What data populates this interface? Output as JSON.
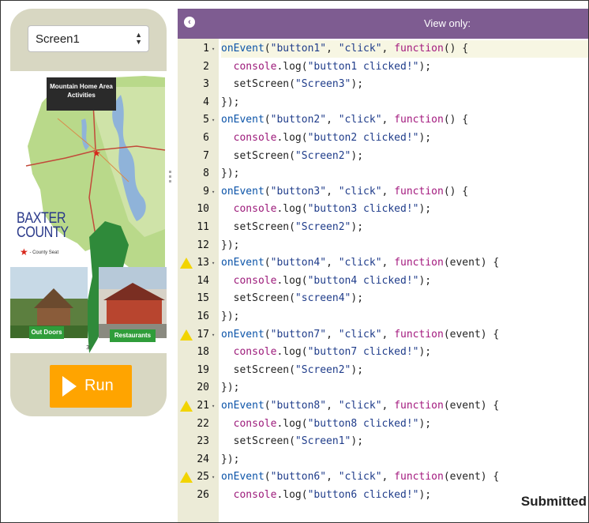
{
  "phone": {
    "screen_select_value": "Screen1",
    "preview": {
      "map_title": "Mountain Home Area Activities",
      "county_line1": "BAXTER",
      "county_line2": "COUNTY",
      "county_seat": "- County Seat",
      "outdoors_button": "Out Doors",
      "restaurants_button": "Restaurants"
    },
    "run_label": "Run"
  },
  "editor": {
    "header_title": "View only:",
    "status": "Submitted",
    "lines": [
      {
        "n": "1",
        "fold": true,
        "warn": false,
        "parts": [
          [
            "fn",
            "onEvent"
          ],
          [
            "p",
            "("
          ],
          [
            "str",
            "\"button1\""
          ],
          [
            "p",
            ", "
          ],
          [
            "str",
            "\"click\""
          ],
          [
            "p",
            ", "
          ],
          [
            "kw",
            "function"
          ],
          [
            "p",
            "() {"
          ]
        ]
      },
      {
        "n": "2",
        "fold": false,
        "warn": false,
        "parts": [
          [
            "p",
            "  "
          ],
          [
            "con",
            "console"
          ],
          [
            "p",
            ".log("
          ],
          [
            "str",
            "\"button1 clicked!\""
          ],
          [
            "p",
            ");"
          ]
        ]
      },
      {
        "n": "3",
        "fold": false,
        "warn": false,
        "parts": [
          [
            "p",
            "  setScreen("
          ],
          [
            "str",
            "\"Screen3\""
          ],
          [
            "p",
            ");"
          ]
        ]
      },
      {
        "n": "4",
        "fold": false,
        "warn": false,
        "parts": [
          [
            "p",
            "});"
          ]
        ]
      },
      {
        "n": "5",
        "fold": true,
        "warn": false,
        "parts": [
          [
            "fn",
            "onEvent"
          ],
          [
            "p",
            "("
          ],
          [
            "str",
            "\"button2\""
          ],
          [
            "p",
            ", "
          ],
          [
            "str",
            "\"click\""
          ],
          [
            "p",
            ", "
          ],
          [
            "kw",
            "function"
          ],
          [
            "p",
            "() {"
          ]
        ]
      },
      {
        "n": "6",
        "fold": false,
        "warn": false,
        "parts": [
          [
            "p",
            "  "
          ],
          [
            "con",
            "console"
          ],
          [
            "p",
            ".log("
          ],
          [
            "str",
            "\"button2 clicked!\""
          ],
          [
            "p",
            ");"
          ]
        ]
      },
      {
        "n": "7",
        "fold": false,
        "warn": false,
        "parts": [
          [
            "p",
            "  setScreen("
          ],
          [
            "str",
            "\"Screen2\""
          ],
          [
            "p",
            ");"
          ]
        ]
      },
      {
        "n": "8",
        "fold": false,
        "warn": false,
        "parts": [
          [
            "p",
            "});"
          ]
        ]
      },
      {
        "n": "9",
        "fold": true,
        "warn": false,
        "parts": [
          [
            "fn",
            "onEvent"
          ],
          [
            "p",
            "("
          ],
          [
            "str",
            "\"button3\""
          ],
          [
            "p",
            ", "
          ],
          [
            "str",
            "\"click\""
          ],
          [
            "p",
            ", "
          ],
          [
            "kw",
            "function"
          ],
          [
            "p",
            "() {"
          ]
        ]
      },
      {
        "n": "10",
        "fold": false,
        "warn": false,
        "parts": [
          [
            "p",
            "  "
          ],
          [
            "con",
            "console"
          ],
          [
            "p",
            ".log("
          ],
          [
            "str",
            "\"button3 clicked!\""
          ],
          [
            "p",
            ");"
          ]
        ]
      },
      {
        "n": "11",
        "fold": false,
        "warn": false,
        "parts": [
          [
            "p",
            "  setScreen("
          ],
          [
            "str",
            "\"Screen2\""
          ],
          [
            "p",
            ");"
          ]
        ]
      },
      {
        "n": "12",
        "fold": false,
        "warn": false,
        "parts": [
          [
            "p",
            "});"
          ]
        ]
      },
      {
        "n": "13",
        "fold": true,
        "warn": true,
        "parts": [
          [
            "fn",
            "onEvent"
          ],
          [
            "p",
            "("
          ],
          [
            "str",
            "\"button4\""
          ],
          [
            "p",
            ", "
          ],
          [
            "str",
            "\"click\""
          ],
          [
            "p",
            ", "
          ],
          [
            "kw",
            "function"
          ],
          [
            "p",
            "(event) {"
          ]
        ]
      },
      {
        "n": "14",
        "fold": false,
        "warn": false,
        "parts": [
          [
            "p",
            "  "
          ],
          [
            "con",
            "console"
          ],
          [
            "p",
            ".log("
          ],
          [
            "str",
            "\"button4 clicked!\""
          ],
          [
            "p",
            ");"
          ]
        ]
      },
      {
        "n": "15",
        "fold": false,
        "warn": false,
        "parts": [
          [
            "p",
            "  setScreen("
          ],
          [
            "str",
            "\"screen4\""
          ],
          [
            "p",
            ");"
          ]
        ]
      },
      {
        "n": "16",
        "fold": false,
        "warn": false,
        "parts": [
          [
            "p",
            "});"
          ]
        ]
      },
      {
        "n": "17",
        "fold": true,
        "warn": true,
        "parts": [
          [
            "fn",
            "onEvent"
          ],
          [
            "p",
            "("
          ],
          [
            "str",
            "\"button7\""
          ],
          [
            "p",
            ", "
          ],
          [
            "str",
            "\"click\""
          ],
          [
            "p",
            ", "
          ],
          [
            "kw",
            "function"
          ],
          [
            "p",
            "(event) {"
          ]
        ]
      },
      {
        "n": "18",
        "fold": false,
        "warn": false,
        "parts": [
          [
            "p",
            "  "
          ],
          [
            "con",
            "console"
          ],
          [
            "p",
            ".log("
          ],
          [
            "str",
            "\"button7 clicked!\""
          ],
          [
            "p",
            ");"
          ]
        ]
      },
      {
        "n": "19",
        "fold": false,
        "warn": false,
        "parts": [
          [
            "p",
            "  setScreen("
          ],
          [
            "str",
            "\"Screen2\""
          ],
          [
            "p",
            ");"
          ]
        ]
      },
      {
        "n": "20",
        "fold": false,
        "warn": false,
        "parts": [
          [
            "p",
            "});"
          ]
        ]
      },
      {
        "n": "21",
        "fold": true,
        "warn": true,
        "parts": [
          [
            "fn",
            "onEvent"
          ],
          [
            "p",
            "("
          ],
          [
            "str",
            "\"button8\""
          ],
          [
            "p",
            ", "
          ],
          [
            "str",
            "\"click\""
          ],
          [
            "p",
            ", "
          ],
          [
            "kw",
            "function"
          ],
          [
            "p",
            "(event) {"
          ]
        ]
      },
      {
        "n": "22",
        "fold": false,
        "warn": false,
        "parts": [
          [
            "p",
            "  "
          ],
          [
            "con",
            "console"
          ],
          [
            "p",
            ".log("
          ],
          [
            "str",
            "\"button8 clicked!\""
          ],
          [
            "p",
            ");"
          ]
        ]
      },
      {
        "n": "23",
        "fold": false,
        "warn": false,
        "parts": [
          [
            "p",
            "  setScreen("
          ],
          [
            "str",
            "\"Screen1\""
          ],
          [
            "p",
            ");"
          ]
        ]
      },
      {
        "n": "24",
        "fold": false,
        "warn": false,
        "parts": [
          [
            "p",
            "});"
          ]
        ]
      },
      {
        "n": "25",
        "fold": true,
        "warn": true,
        "parts": [
          [
            "fn",
            "onEvent"
          ],
          [
            "p",
            "("
          ],
          [
            "str",
            "\"button6\""
          ],
          [
            "p",
            ", "
          ],
          [
            "str",
            "\"click\""
          ],
          [
            "p",
            ", "
          ],
          [
            "kw",
            "function"
          ],
          [
            "p",
            "(event) {"
          ]
        ]
      },
      {
        "n": "26",
        "fold": false,
        "warn": false,
        "parts": [
          [
            "p",
            "  "
          ],
          [
            "con",
            "console"
          ],
          [
            "p",
            ".log("
          ],
          [
            "str",
            "\"button6 clicked!\""
          ],
          [
            "p",
            ");"
          ]
        ]
      }
    ]
  },
  "colors": {
    "header_purple": "#7e5c91",
    "run_orange": "#ffa400",
    "phone_bezel": "#d8d7c2",
    "gutter": "#ecebd7",
    "warning_yellow": "#f2d400"
  }
}
